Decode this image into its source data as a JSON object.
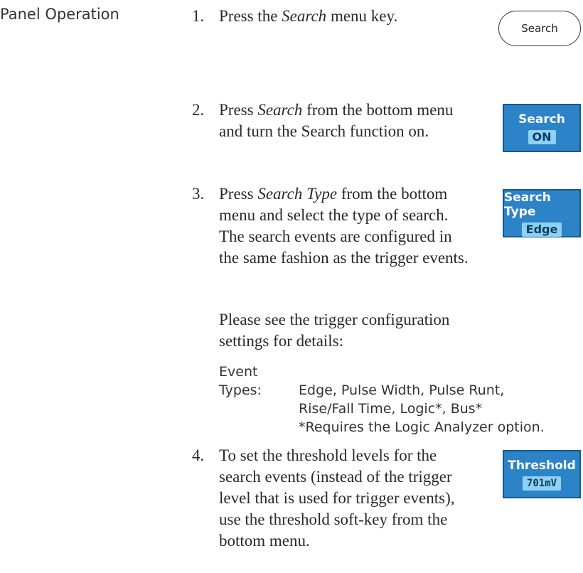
{
  "section_label": "Panel Operation",
  "steps": [
    {
      "number": "1.",
      "text_before": "Press the ",
      "italic": "Search",
      "text_after": " menu key."
    },
    {
      "number": "2.",
      "text_before": "Press ",
      "italic": "Search",
      "text_after": " from the bottom menu and turn the Search function on."
    },
    {
      "number": "3.",
      "text_before": "Press ",
      "italic": "Search Type",
      "text_after": " from the bottom menu and select the type of search. The search events are configured in the same fashion as the trigger events."
    },
    {
      "number": "4.",
      "text": "To set the threshold levels for the search events (instead of the trigger level that is used for trigger events), use the threshold soft-key from the bottom menu."
    }
  ],
  "note": "Please see the trigger configuration settings for details:",
  "event_types": {
    "label_line1": "Event",
    "label_line2": "Types:",
    "line1": "Edge, Pulse Width, Pulse Runt,",
    "line2": "Rise/Fall Time, Logic*, Bus*",
    "line3": "*Requires the Logic Analyzer option."
  },
  "buttons": {
    "search_key": "Search"
  },
  "softkeys": {
    "search": {
      "title": "Search",
      "value": "ON"
    },
    "search_type": {
      "title": "Search Type",
      "value": "Edge"
    },
    "threshold": {
      "title": "Threshold",
      "value": "701mV"
    }
  },
  "colors": {
    "softkey_background": "#2c83c7",
    "softkey_value_highlight": "#8fd1f2"
  }
}
